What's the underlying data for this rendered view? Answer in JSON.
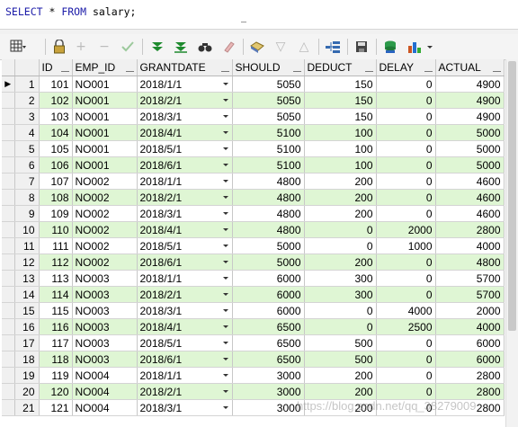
{
  "editor": {
    "sql_keyword1": "SELECT",
    "sql_star": " * ",
    "sql_keyword2": "FROM",
    "sql_rest": " salary;"
  },
  "toolbar": {
    "icons": [
      "grid-view-icon",
      "lock-icon",
      "add-record-icon",
      "remove-record-icon",
      "post-changes-icon",
      "filter-icon",
      "clear-filter-icon",
      "find-icon",
      "clear-icon",
      "query-by-example-icon",
      "sort-down-icon",
      "sort-up-icon",
      "export-icon",
      "save-icon",
      "connect-icon",
      "chart-icon"
    ]
  },
  "table": {
    "columns": [
      "ID",
      "EMP_ID",
      "GRANTDATE",
      "SHOULD",
      "DEDUCT",
      "DELAY",
      "ACTUAL"
    ],
    "rows": [
      [
        "1",
        "101",
        "NO001",
        "2018/1/1",
        "5050",
        "150",
        "0",
        "4900"
      ],
      [
        "2",
        "102",
        "NO001",
        "2018/2/1",
        "5050",
        "150",
        "0",
        "4900"
      ],
      [
        "3",
        "103",
        "NO001",
        "2018/3/1",
        "5050",
        "150",
        "0",
        "4900"
      ],
      [
        "4",
        "104",
        "NO001",
        "2018/4/1",
        "5100",
        "100",
        "0",
        "5000"
      ],
      [
        "5",
        "105",
        "NO001",
        "2018/5/1",
        "5100",
        "100",
        "0",
        "5000"
      ],
      [
        "6",
        "106",
        "NO001",
        "2018/6/1",
        "5100",
        "100",
        "0",
        "5000"
      ],
      [
        "7",
        "107",
        "NO002",
        "2018/1/1",
        "4800",
        "200",
        "0",
        "4600"
      ],
      [
        "8",
        "108",
        "NO002",
        "2018/2/1",
        "4800",
        "200",
        "0",
        "4600"
      ],
      [
        "9",
        "109",
        "NO002",
        "2018/3/1",
        "4800",
        "200",
        "0",
        "4600"
      ],
      [
        "10",
        "110",
        "NO002",
        "2018/4/1",
        "4800",
        "0",
        "2000",
        "2800"
      ],
      [
        "11",
        "111",
        "NO002",
        "2018/5/1",
        "5000",
        "0",
        "1000",
        "4000"
      ],
      [
        "12",
        "112",
        "NO002",
        "2018/6/1",
        "5000",
        "200",
        "0",
        "4800"
      ],
      [
        "13",
        "113",
        "NO003",
        "2018/1/1",
        "6000",
        "300",
        "0",
        "5700"
      ],
      [
        "14",
        "114",
        "NO003",
        "2018/2/1",
        "6000",
        "300",
        "0",
        "5700"
      ],
      [
        "15",
        "115",
        "NO003",
        "2018/3/1",
        "6000",
        "0",
        "4000",
        "2000"
      ],
      [
        "16",
        "116",
        "NO003",
        "2018/4/1",
        "6500",
        "0",
        "2500",
        "4000"
      ],
      [
        "17",
        "117",
        "NO003",
        "2018/5/1",
        "6500",
        "500",
        "0",
        "6000"
      ],
      [
        "18",
        "118",
        "NO003",
        "2018/6/1",
        "6500",
        "500",
        "0",
        "6000"
      ],
      [
        "19",
        "119",
        "NO004",
        "2018/1/1",
        "3000",
        "200",
        "0",
        "2800"
      ],
      [
        "20",
        "120",
        "NO004",
        "2018/2/1",
        "3000",
        "200",
        "0",
        "2800"
      ],
      [
        "21",
        "121",
        "NO004",
        "2018/3/1",
        "3000",
        "200",
        "0",
        "2800"
      ]
    ],
    "current_row_indicator": "▶"
  },
  "watermark": "https://blog.csdn.net/qq_38279009"
}
